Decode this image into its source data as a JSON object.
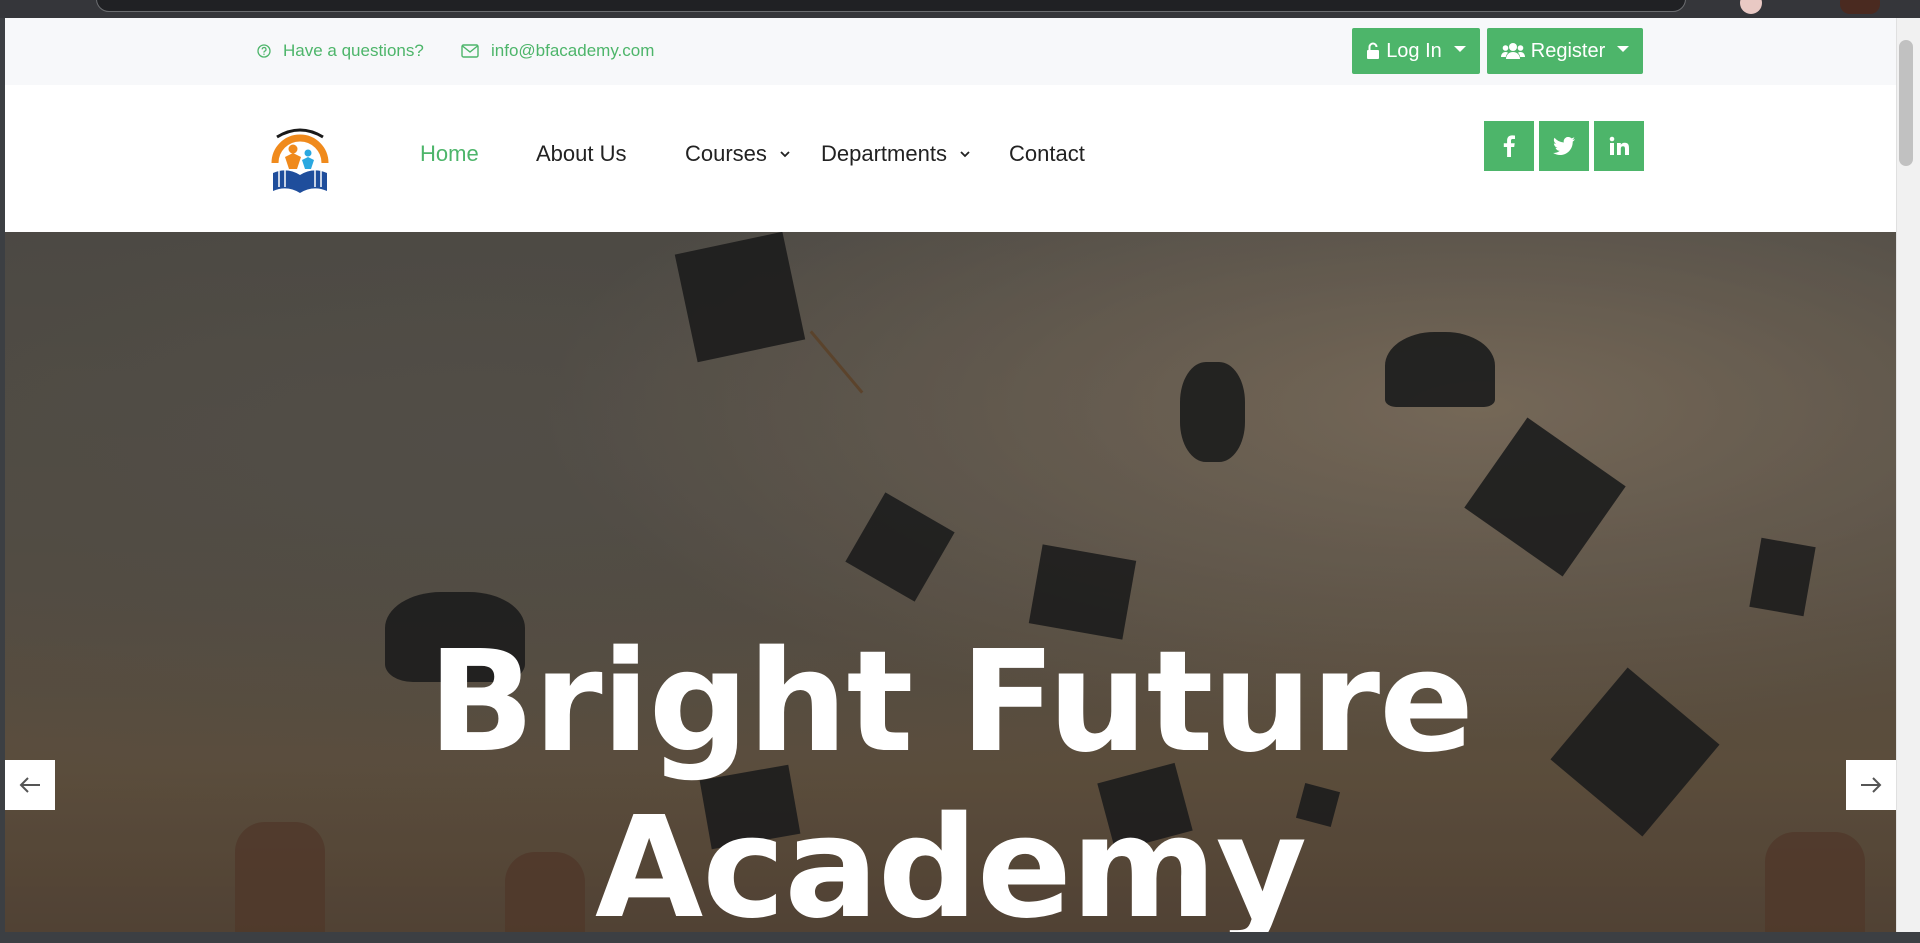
{
  "topbar": {
    "question_text": "Have a questions?",
    "email_text": "info@bfacademy.com",
    "login_label": "Log In",
    "register_label": "Register"
  },
  "nav": {
    "items": [
      {
        "label": "Home",
        "active": true
      },
      {
        "label": "About Us"
      },
      {
        "label": "Courses",
        "dropdown": true
      },
      {
        "label": "Departments",
        "dropdown": true
      },
      {
        "label": "Contact"
      }
    ],
    "social": [
      "facebook-icon",
      "twitter-icon",
      "linkedin-icon"
    ]
  },
  "hero": {
    "title_line1": "Bright Future",
    "title_line2": "Academy"
  },
  "colors": {
    "accent": "#4db56a",
    "topbar_bg": "#f7f8fa"
  }
}
